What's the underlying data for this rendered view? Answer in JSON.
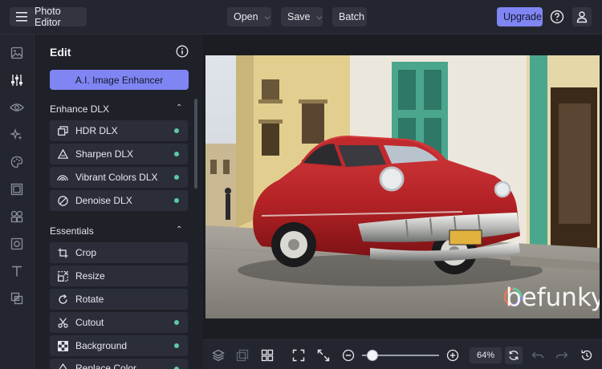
{
  "topbar": {
    "app_title": "Photo Editor",
    "open_label": "Open",
    "save_label": "Save",
    "batch_label": "Batch",
    "upgrade_label": "Upgrade",
    "accent": "#7f85f2"
  },
  "rail": {
    "items": [
      "image-icon",
      "sliders-icon",
      "eye-icon",
      "sparkles-icon",
      "palette-icon",
      "frame-icon",
      "shapes-icon",
      "texture-icon",
      "text-icon",
      "overlay-icon"
    ],
    "active_index": 1
  },
  "panel": {
    "title": "Edit",
    "ai_button": "A.I. Image Enhancer",
    "sections": [
      {
        "title": "Enhance DLX",
        "items": [
          {
            "label": "HDR DLX",
            "icon": "hdr-icon",
            "badge": true
          },
          {
            "label": "Sharpen DLX",
            "icon": "sharpen-icon",
            "badge": true
          },
          {
            "label": "Vibrant Colors DLX",
            "icon": "rainbow-icon",
            "badge": true
          },
          {
            "label": "Denoise DLX",
            "icon": "denoise-icon",
            "badge": true
          }
        ]
      },
      {
        "title": "Essentials",
        "items": [
          {
            "label": "Crop",
            "icon": "crop-icon",
            "badge": false
          },
          {
            "label": "Resize",
            "icon": "resize-icon",
            "badge": false
          },
          {
            "label": "Rotate",
            "icon": "rotate-icon",
            "badge": false
          },
          {
            "label": "Cutout",
            "icon": "scissors-icon",
            "badge": true
          },
          {
            "label": "Background",
            "icon": "checker-icon",
            "badge": true
          },
          {
            "label": "Replace Color",
            "icon": "color-icon",
            "badge": true
          }
        ]
      }
    ],
    "badge_color": "#5ec9a3"
  },
  "canvas": {
    "watermark": "befunky"
  },
  "bottombar": {
    "zoom": "64%",
    "zoom_fraction": 0.1
  }
}
